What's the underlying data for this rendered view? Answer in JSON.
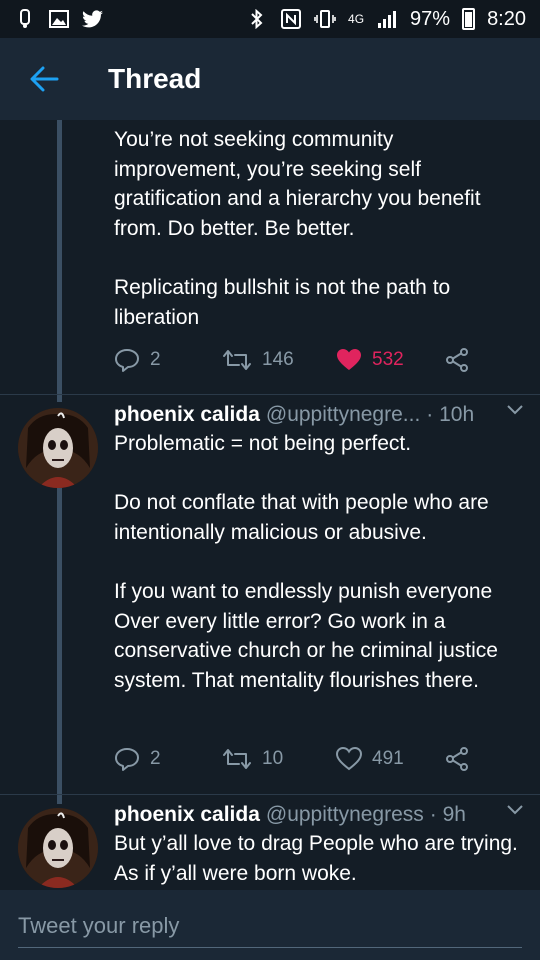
{
  "status_bar": {
    "battery": "97%",
    "time": "8:20",
    "network": "4G"
  },
  "app_bar": {
    "title": "Thread"
  },
  "tweets": [
    {
      "text": "You’re not seeking community improvement, you’re seeking self gratification and a hierarchy you benefit from. Do better. Be better.\n\nReplicating bullshit is not the path to liberation",
      "replies": "2",
      "retweets": "146",
      "likes": "532",
      "liked": true
    },
    {
      "name": "phoenix calida",
      "handle": "@uppittynegre...",
      "time": "· 10h",
      "text": "Problematic = not being perfect.\n\nDo not conflate that with people who are intentionally malicious or abusive.\n\nIf you want to endlessly punish everyone Over every little error? Go work in a conservative church or he criminal justice system. That mentality flourishes there.",
      "replies": "2",
      "retweets": "10",
      "likes": "491",
      "liked": false
    },
    {
      "name": "phoenix calida",
      "handle": "@uppittynegress",
      "time": "· 9h",
      "text": "But y’all love to drag People who are trying. As if y’all were born woke."
    }
  ],
  "reply": {
    "placeholder": "Tweet your reply"
  },
  "colors": {
    "background": "#141d26",
    "app_bar": "#1b2836",
    "accent": "#1da1f2",
    "like_active": "#e0245e",
    "muted": "#8899a6"
  }
}
